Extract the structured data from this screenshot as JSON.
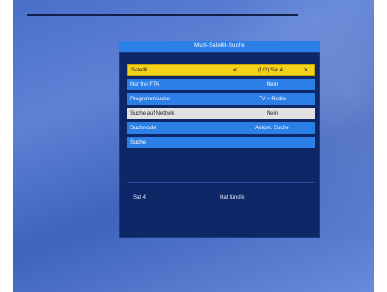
{
  "window": {
    "title": "Multi-Satellit-Suche"
  },
  "rows": [
    {
      "label": "Satellit",
      "value": "(1/2) Sat 4",
      "left_arrow": "<",
      "right_arrow": ">"
    },
    {
      "label": "Nur frei FTA",
      "value": "Nein"
    },
    {
      "label": "Programmsuche",
      "value": "TV + Radio"
    },
    {
      "label": "Suche auf Netzwk.",
      "value": "Nein"
    },
    {
      "label": "Suchmode",
      "value": "Autom. Suche"
    },
    {
      "label": "Suche",
      "value": ""
    }
  ],
  "status": {
    "satellite": "Sat 4",
    "right": "Hat fünd k"
  },
  "colors": {
    "background": "#5a7fd4",
    "row": "#2b7fe6",
    "panel": "#0e2766",
    "highlight_yellow": "#f5d21a",
    "highlight_white": "#e2e2e2"
  }
}
